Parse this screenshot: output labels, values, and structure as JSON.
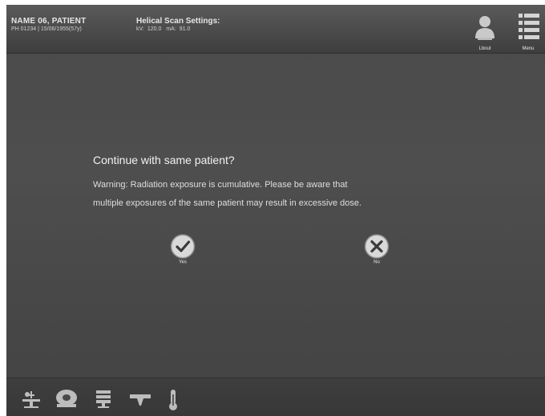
{
  "header": {
    "patient_name": "NAME 06, PATIENT",
    "patient_meta": "PH 01234 | 15/06/1955(57y)",
    "scan_title": "Helical Scan Settings:",
    "kv_label": "kV:",
    "kv_value": "120.0",
    "ma_label": "mA:",
    "ma_value": "91.0",
    "logout_label": "Lbout",
    "logout_icon": "user-icon",
    "menu_label": "Menu",
    "menu_icon": "menu-list-icon"
  },
  "dialog": {
    "title": "Continue with same patient?",
    "warning_line1": "Warning: Radiation exposure is cumulative.  Please be aware that",
    "warning_line2": "multiple exposures of the same patient may result in excessive dose.",
    "yes_label": "Yes",
    "yes_icon": "check-icon",
    "no_label": "No",
    "no_icon": "close-icon"
  },
  "toolbar": {
    "tools": [
      {
        "icon": "patient-table-icon"
      },
      {
        "icon": "scanner-gantry-icon"
      },
      {
        "icon": "workstation-icon"
      },
      {
        "icon": "tube-icon"
      },
      {
        "icon": "thermometer-icon"
      }
    ]
  },
  "colors": {
    "background": "#4a4a4a",
    "header": "#4a4a4a",
    "text": "#f2f2f2",
    "icon_fill": "#bdbdbd"
  }
}
